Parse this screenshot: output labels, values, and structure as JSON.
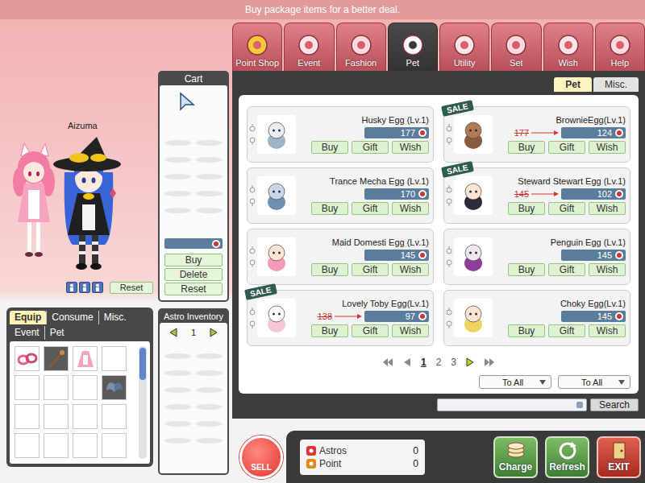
{
  "banner": "Buy package items for a better deal.",
  "preview": {
    "character_name": "Aizuma",
    "reset": "Reset"
  },
  "cart": {
    "title": "Cart",
    "buttons": [
      "Buy",
      "Delete",
      "Reset"
    ]
  },
  "tabs": [
    {
      "label": "Point Shop",
      "selected": false
    },
    {
      "label": "Event",
      "selected": false
    },
    {
      "label": "Fashion",
      "selected": false
    },
    {
      "label": "Pet",
      "selected": true
    },
    {
      "label": "Utility",
      "selected": false
    },
    {
      "label": "Set",
      "selected": false
    },
    {
      "label": "Wish",
      "selected": false
    },
    {
      "label": "Help",
      "selected": false
    }
  ],
  "subtabs": [
    {
      "label": "Pet",
      "selected": true
    },
    {
      "label": "Misc.",
      "selected": false
    }
  ],
  "sale_label": "SALE",
  "item_buttons": [
    "Buy",
    "Gift",
    "Wish"
  ],
  "items": [
    {
      "name": "Husky Egg (Lv.1)",
      "price": "177",
      "sale": false
    },
    {
      "name": "BrownieEgg(Lv.1)",
      "price": "124",
      "sale": true,
      "original_price": "177"
    },
    {
      "name": "Trance Mecha Egg (Lv.1)",
      "price": "170",
      "sale": false
    },
    {
      "name": "Steward Stewart Egg (Lv.1)",
      "price": "102",
      "sale": true,
      "original_price": "145"
    },
    {
      "name": "Maid Domesti Egg (Lv.1)",
      "price": "145",
      "sale": false
    },
    {
      "name": "Penguin Egg (Lv.1)",
      "price": "145",
      "sale": false
    },
    {
      "name": "Lovely Toby Egg(Lv.1)",
      "price": "97",
      "sale": true,
      "original_price": "138"
    },
    {
      "name": "Choky Egg(Lv.1)",
      "price": "145",
      "sale": false
    }
  ],
  "pagination": [
    {
      "label": "1",
      "selected": true
    },
    {
      "label": "2",
      "selected": false
    },
    {
      "label": "3",
      "selected": false
    }
  ],
  "dropdowns": [
    "To All",
    "To All"
  ],
  "search_button": "Search",
  "inventory": {
    "tab_rows": [
      [
        {
          "label": "Equip",
          "selected": true
        },
        {
          "label": "Consume",
          "selected": false
        },
        {
          "label": "Misc.",
          "selected": false
        }
      ],
      [
        {
          "label": "Event",
          "selected": false
        },
        {
          "label": "Pet",
          "selected": false
        }
      ]
    ],
    "slots": [
      {
        "kind": "accessory"
      },
      {
        "kind": "weapon"
      },
      {
        "kind": "outfit"
      },
      {
        "kind": "empty"
      },
      {
        "kind": "empty"
      },
      {
        "kind": "empty"
      },
      {
        "kind": "empty"
      },
      {
        "kind": "wings"
      },
      {
        "kind": "empty"
      },
      {
        "kind": "empty"
      },
      {
        "kind": "empty"
      },
      {
        "kind": "empty"
      },
      {
        "kind": "empty"
      },
      {
        "kind": "empty"
      },
      {
        "kind": "empty"
      },
      {
        "kind": "empty"
      }
    ]
  },
  "astro_inventory": {
    "title": "Astro Inventory",
    "page": "1"
  },
  "currency": [
    {
      "name": "Astros",
      "value": "0"
    },
    {
      "name": "Point",
      "value": "0"
    }
  ],
  "sell": "SELL",
  "actions": [
    {
      "label": "Charge",
      "kind": "charge"
    },
    {
      "label": "Refresh",
      "kind": "refresh"
    },
    {
      "label": "EXIT",
      "kind": "exit"
    }
  ]
}
